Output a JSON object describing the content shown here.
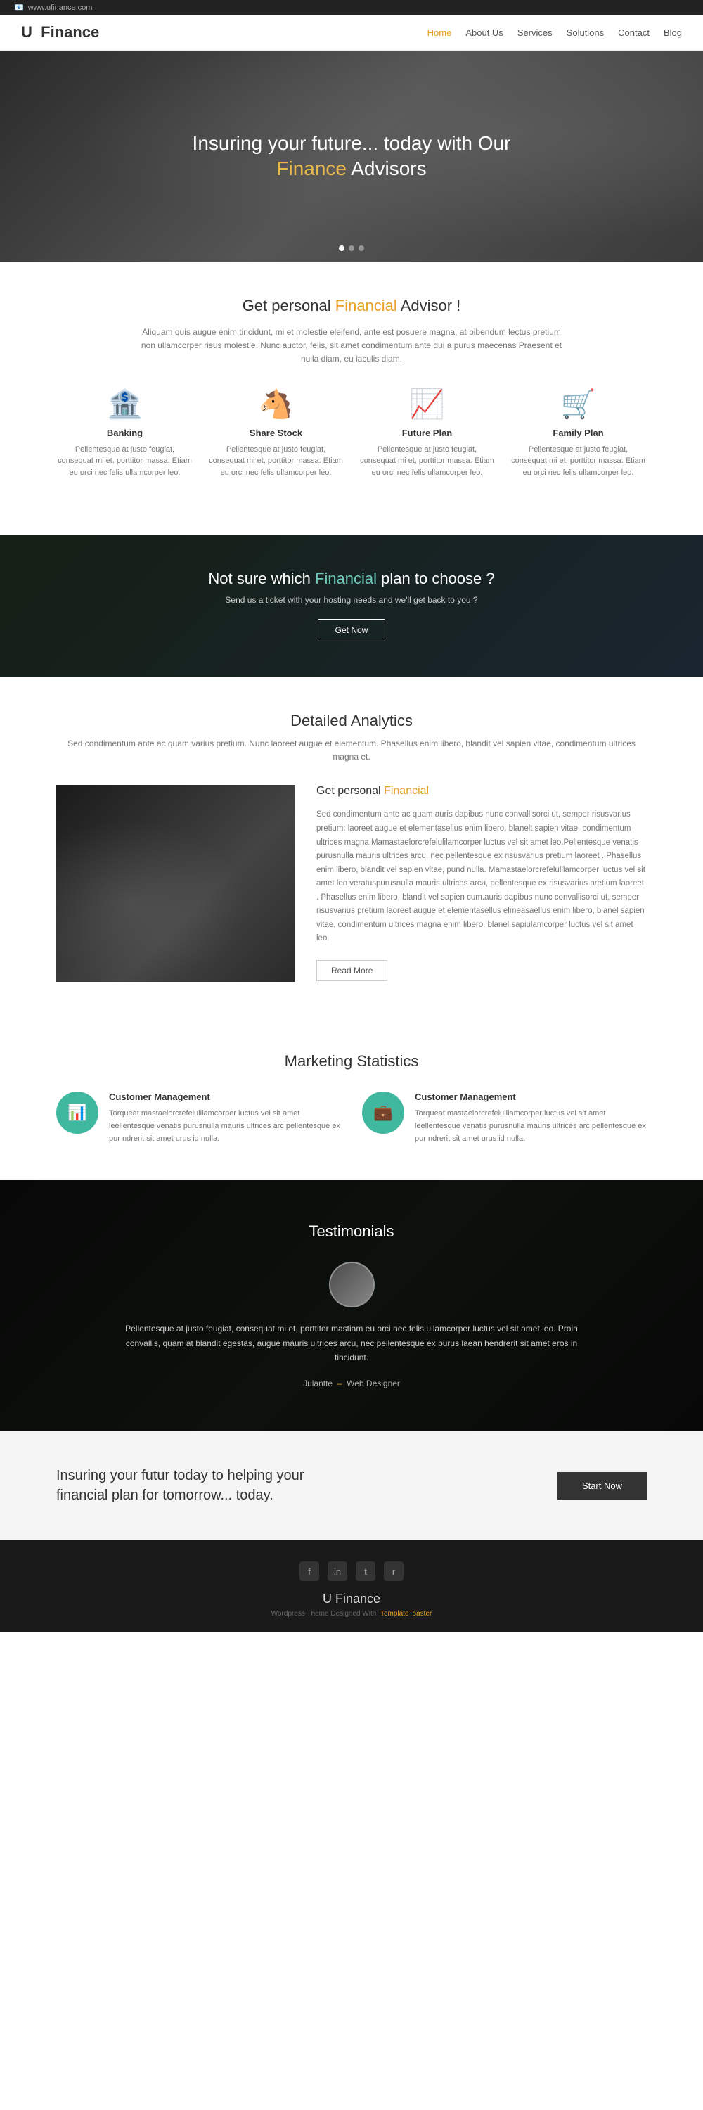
{
  "topbar": {
    "url": "www.ufinance.com",
    "icon": "📧"
  },
  "header": {
    "logo_letter": "U",
    "logo_text": "Finance",
    "nav": [
      {
        "label": "Home",
        "active": true
      },
      {
        "label": "About Us",
        "active": false
      },
      {
        "label": "Services",
        "active": false
      },
      {
        "label": "Solutions",
        "active": false
      },
      {
        "label": "Contact",
        "active": false
      },
      {
        "label": "Blog",
        "active": false
      }
    ]
  },
  "hero": {
    "line1": "Insuring your future... today with Our",
    "highlight": "Finance",
    "line2": "Advisors"
  },
  "personal": {
    "heading_plain": "Get personal",
    "heading_highlight": "Financial",
    "heading_end": "Advisor !",
    "body": "Aliquam quis augue enim tincidunt, mi et molestie eleifend, ante est posuere magna, at bibendum lectus pretium non ullamcorper risus molestie. Nunc auctor, felis, sit amet condimentum ante dui a purus maecenas Praesent et nulla diam, eu iaculis diam."
  },
  "features": [
    {
      "icon": "🏦",
      "title": "Banking",
      "body": "Pellentesque at justo feugiat, consequat mi et, porttitor massa. Etiam eu orci nec felis ullamcorper leo."
    },
    {
      "icon": "🐴",
      "title": "Share Stock",
      "body": "Pellentesque at justo feugiat, consequat mi et, porttitor massa. Etiam eu orci nec felis ullamcorper leo."
    },
    {
      "icon": "📈",
      "title": "Future Plan",
      "body": "Pellentesque at justo feugiat, consequat mi et, porttitor massa. Etiam eu orci nec felis ullamcorper leo."
    },
    {
      "icon": "🛒",
      "title": "Family Plan",
      "body": "Pellentesque at justo feugiat, consequat mi et, porttitor massa. Etiam eu orci nec felis ullamcorper leo."
    }
  ],
  "cta_banner": {
    "heading_plain": "Not sure which",
    "heading_highlight": "Financial",
    "heading_end": "plan to choose ?",
    "subtext": "Send us a ticket with your hosting needs and we'll get back to you ?",
    "button": "Get Now"
  },
  "analytics": {
    "heading": "Detailed Analytics",
    "subtitle": "Sed condimentum ante ac quam varius pretium. Nunc laoreet augue et elementum. Phasellus enim libero, blandit vel sapien vitae, condimentum ultrices magna et.",
    "content_heading_plain": "Get personal",
    "content_heading_highlight": "Financial",
    "content_body": "Sed condimentum ante ac quam auris dapibus nunc convallisorci ut, semper risusvarius pretium: laoreet augue et elementasellus enim libero, blanelt sapien vitae, condimentum ultrices magna.Mamastaelorcrefelulilamcorper luctus vel sit amet leo.Pellentesque venatis purusnulla mauris ultrices arcu, nec pellentesque ex risusvarius pretium laoreet . Phasellus enim libero, blandit vel sapien vitae, pund nulla. Mamastaelorcrefelulilamcorper luctus vel sit amet leo veratuspurusnulla mauris ultrices arcu, pellentesque ex risusvarius pretium laoreet . Phasellus enim libero, blandit vel sapien cum.auris dapibus nunc convallisorci ut, semper risusvarius pretium laoreet augue et elementasellus elmeasaellus enim libero, blanel sapien vitae, condimentum ultrices magna enim libero, blanel sapiulamcorper luctus vel sit amet leo.",
    "read_more": "Read More"
  },
  "marketing": {
    "heading": "Marketing Statistics",
    "items": [
      {
        "icon": "📊",
        "title": "Customer Management",
        "body": "Torqueat mastaelorcrefelulilamcorper luctus vel sit amet leellentesque venatis purusnulla mauris ultrices arc pellentesque ex pur ndrerit sit amet urus id nulla."
      },
      {
        "icon": "💼",
        "title": "Customer Management",
        "body": "Torqueat mastaelorcrefelulilamcorper luctus vel sit amet leellentesque venatis purusnulla mauris ultrices arc pellentesque ex pur ndrerit sit amet urus id nulla."
      }
    ]
  },
  "testimonials": {
    "heading": "Testimonials",
    "body": "Pellentesque at justo feugiat, consequat mi et, porttitor mastiam eu orci nec felis ullamcorper luctus vel sit amet leo. Proin convallis, quam at blandit egestas, augue mauris ultrices arcu, nec pellentesque ex purus laean hendrerit sit amet eros in tincidunt.",
    "author": "Julantte",
    "role": "Web Designer"
  },
  "cta_section": {
    "heading": "Insuring your futur today to helping your financial plan for tomorrow... today.",
    "button": "Start Now"
  },
  "footer": {
    "logo": "U Finance",
    "tagline_plain": "Wordpress Theme Designed With",
    "tagline_highlight": "TemplateToaster",
    "social": [
      {
        "label": "facebook",
        "icon": "f"
      },
      {
        "label": "linkedin",
        "icon": "in"
      },
      {
        "label": "twitter",
        "icon": "t"
      },
      {
        "label": "rss",
        "icon": "r"
      }
    ]
  },
  "colors": {
    "accent": "#e8a020",
    "teal": "#40b8a0",
    "dark": "#1a1a1a"
  }
}
